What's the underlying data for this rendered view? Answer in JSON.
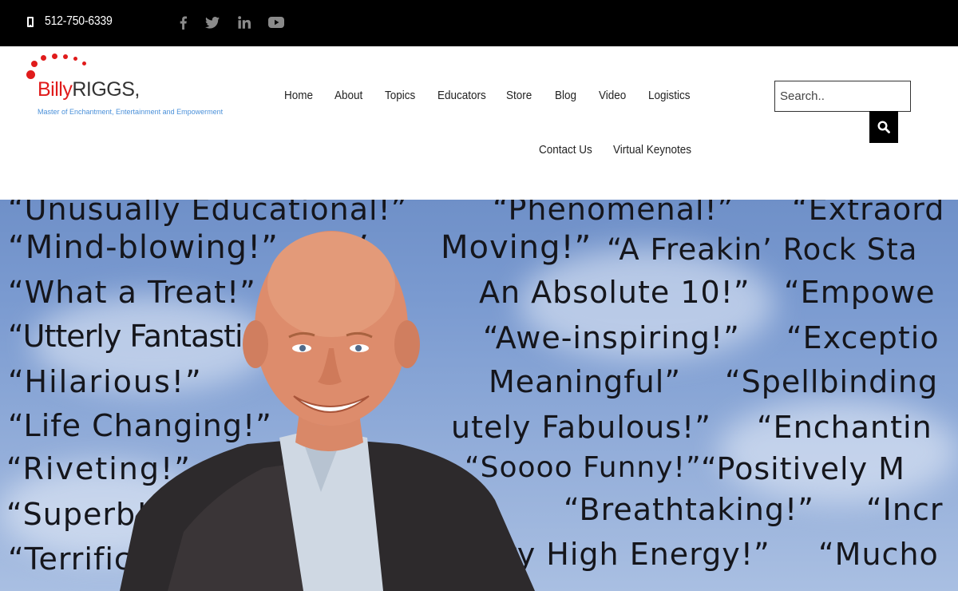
{
  "topbar": {
    "phone": "512-750-6339",
    "social": [
      {
        "icon": "facebook-icon"
      },
      {
        "icon": "twitter-icon"
      },
      {
        "icon": "linkedin-icon"
      },
      {
        "icon": "youtube-icon"
      }
    ]
  },
  "logo": {
    "first": "Billy",
    "last": "RIGGS,",
    "tagline": "Master of Enchantment, Entertainment and Empowerment"
  },
  "nav": {
    "home": "Home",
    "about": "About",
    "topics": "Topics",
    "educators": "Educators",
    "store": "Store",
    "blog": "Blog",
    "video": "Video",
    "logistics": "Logistics",
    "contact": "Contact Us",
    "virtual": "Virtual Keynotes"
  },
  "search": {
    "placeholder": "Search.."
  },
  "hero": {
    "quotes": {
      "q1": "“Unusually Educational!”",
      "q2": "“Phenomenal!”",
      "q3": "“Extraord",
      "q4": "“Mind-blowing!”",
      "q5": "“V",
      "q6": "Moving!”",
      "q7": "“A Freakin’ Rock Sta",
      "q8": "“What a Treat!”",
      "q9": "An Absolute 10!”",
      "q10": "“Empowe",
      "q11": "“Utterly Fantastic!”",
      "q12": "“Awe-inspiring!”",
      "q13": "“Exceptio",
      "q14": "“Hilarious!”",
      "q15": "Meaningful”",
      "q16": "“Spellbinding",
      "q17": "“Life Changing!”",
      "q18": "utely Fabulous!”",
      "q19": "“Enchantin",
      "q20": "“Riveting!”",
      "q21": "“Soooo Funny!”",
      "q22": "“Positively M",
      "q23": "“Superb!”",
      "q24": "“Breathtaking!”",
      "q25": "“Incr",
      "q26": "“Terrific Showman!”",
      "q27": "“Very High Energy!”",
      "q28": "“Mucho"
    }
  },
  "colors": {
    "topbar": "#000000",
    "accent_red": "#e01b1b",
    "tagline_blue": "#4a90d9",
    "social_gray": "#8a8a8a"
  }
}
